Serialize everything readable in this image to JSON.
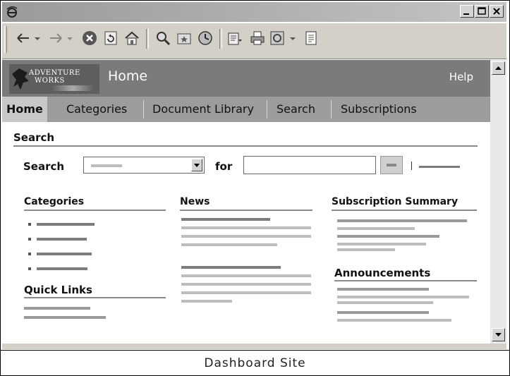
{
  "logo": {
    "line1": "ADVENTURE",
    "line2": "WORKS"
  },
  "header": {
    "title": "Home",
    "help": "Help"
  },
  "nav": {
    "tabs": [
      "Home",
      "Categories",
      "Document Library",
      "Search",
      "Subscriptions"
    ]
  },
  "search": {
    "heading": "Search",
    "label": "Search",
    "for_label": "for"
  },
  "columns": {
    "categories": "Categories",
    "quick_links": "Quick Links",
    "news": "News",
    "subscription_summary": "Subscription Summary",
    "announcements": "Announcements"
  },
  "caption": "Dashboard Site",
  "colors": {
    "header": "#7b7b7b",
    "nav": "#9c9c9c",
    "active_tab": "#c8c8c8"
  }
}
